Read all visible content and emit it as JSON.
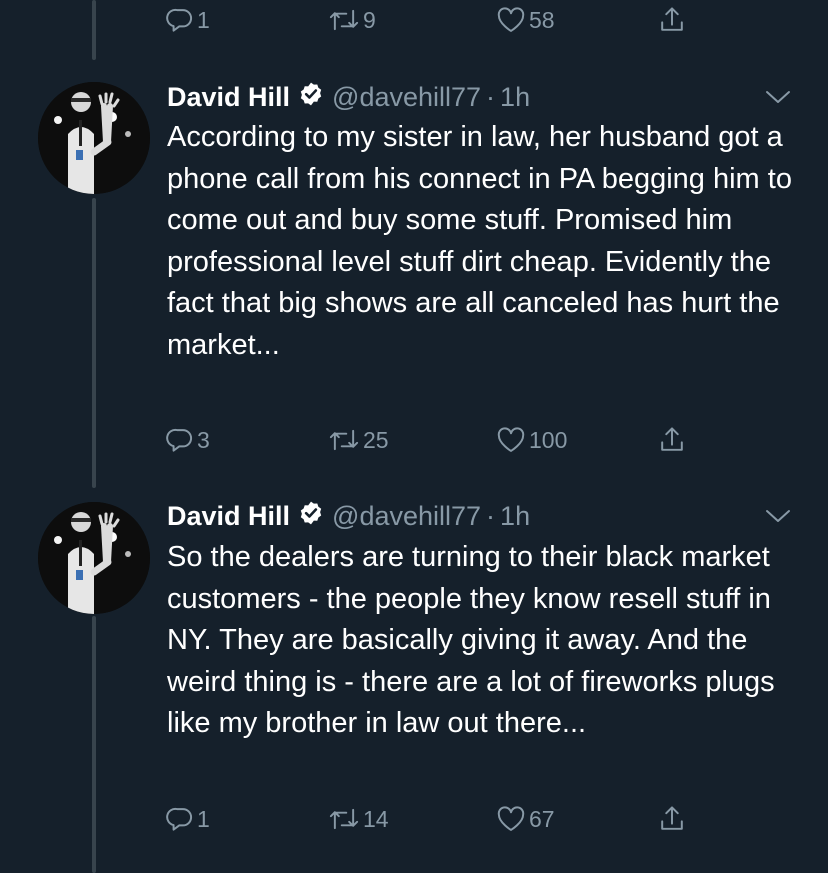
{
  "colors": {
    "background": "#15202b",
    "text_primary": "#ffffff",
    "text_secondary": "#8899a6",
    "thread_line": "#38444d",
    "verified_badge": "#ffffff"
  },
  "top_actions": {
    "reply_count": "1",
    "retweet_count": "9",
    "like_count": "58"
  },
  "tweets": [
    {
      "author_name": "David Hill",
      "handle": "@davehill77",
      "separator": "·",
      "time": "1h",
      "verified_icon": "verified-badge-icon",
      "text": "According to my sister in law, her husband got a phone call from his connect in PA begging him to come out and buy some stuff. Promised him professional level stuff dirt cheap. Evidently the fact that big shows are all canceled has hurt the market...",
      "reply_count": "3",
      "retweet_count": "25",
      "like_count": "100"
    },
    {
      "author_name": "David Hill",
      "handle": "@davehill77",
      "separator": "·",
      "time": "1h",
      "verified_icon": "verified-badge-icon",
      "text": "So the dealers are turning to their black market customers - the people they know resell stuff in NY. They are basically giving it away. And the weird thing is - there are a lot of fireworks plugs like my brother in law out there...",
      "reply_count": "1",
      "retweet_count": "14",
      "like_count": "67"
    }
  ],
  "icons": {
    "reply": "reply-icon",
    "retweet": "retweet-icon",
    "like": "heart-icon",
    "share": "share-icon",
    "menu": "chevron-down-icon"
  }
}
